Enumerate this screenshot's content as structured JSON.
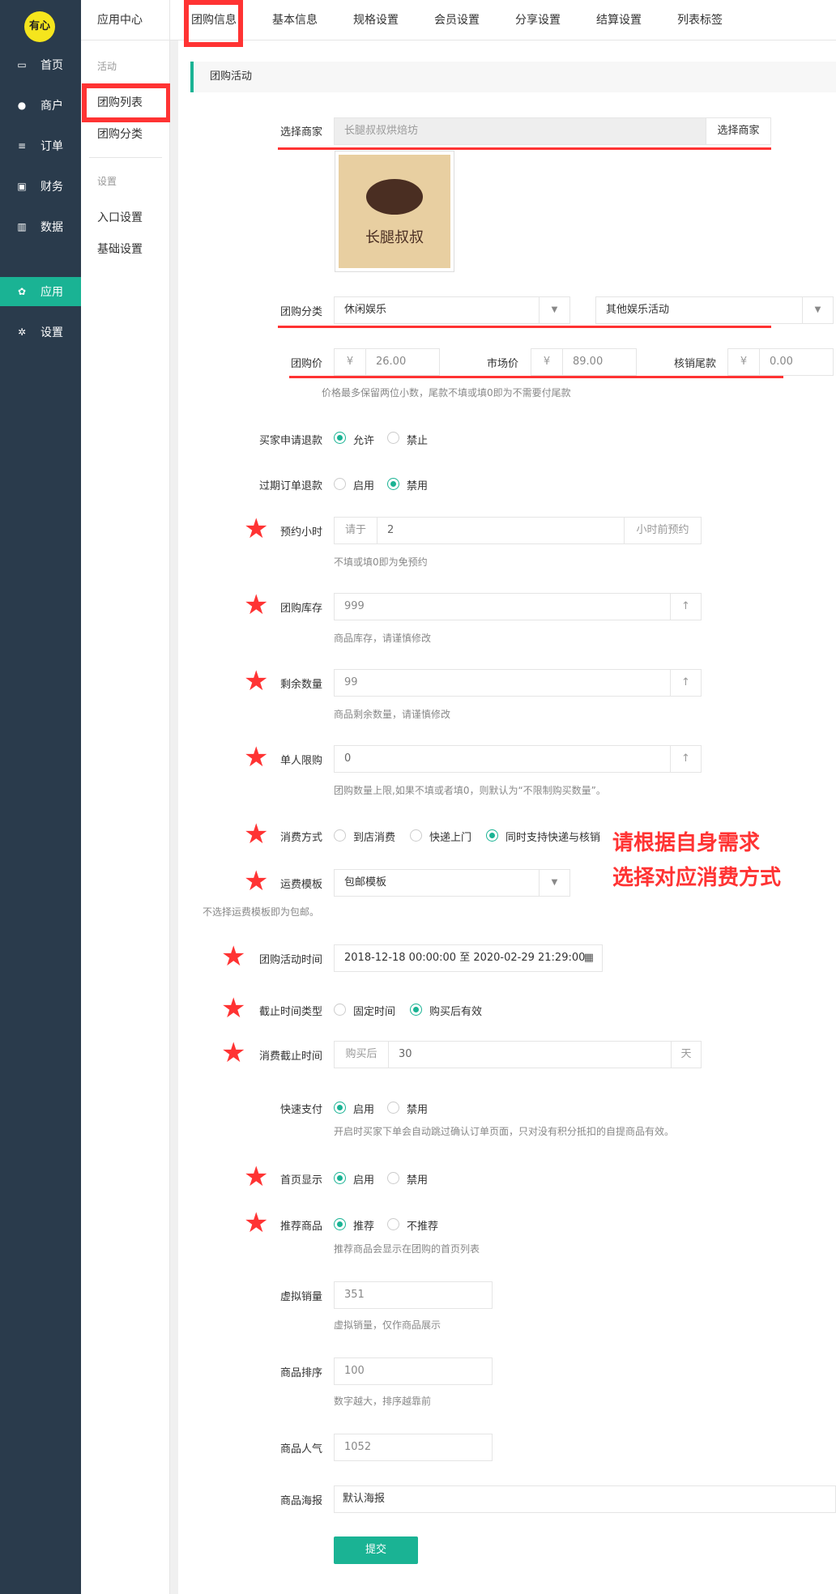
{
  "app": {
    "logo": "有心"
  },
  "nav": [
    {
      "label": "首页",
      "icon": "monitor-icon"
    },
    {
      "label": "商户",
      "icon": "users-icon"
    },
    {
      "label": "订单",
      "icon": "list-icon"
    },
    {
      "label": "财务",
      "icon": "money-icon"
    },
    {
      "label": "数据",
      "icon": "chart-icon"
    },
    {
      "label": "应用",
      "icon": "apps-icon"
    },
    {
      "label": "设置",
      "icon": "gear-icon"
    }
  ],
  "subnav": {
    "title": "应用中心",
    "group1": "活动",
    "items1": [
      "团购列表",
      "团购分类"
    ],
    "group2": "设置",
    "items2": [
      "入口设置",
      "基础设置"
    ]
  },
  "tabs": [
    "团购信息",
    "基本信息",
    "规格设置",
    "会员设置",
    "分享设置",
    "结算设置",
    "列表标签"
  ],
  "section": "团购活动",
  "form": {
    "merchant_label": "选择商家",
    "merchant_value": "长腿叔叔烘焙坊",
    "merchant_button": "选择商家",
    "image_close": "×",
    "image_brand": "长腿叔叔",
    "category_label": "团购分类",
    "category1": "休闲娱乐",
    "category2": "其他娱乐活动",
    "price_label": "团购价",
    "price_currency": "¥",
    "price_value": "26.00",
    "market_label": "市场价",
    "market_value": "89.00",
    "balance_label": "核销尾款",
    "balance_value": "0.00",
    "price_help": "价格最多保留两位小数，尾款不填或填0即为不需要付尾款",
    "refund_label": "买家申请退款",
    "refund_opts": [
      "允许",
      "禁止"
    ],
    "expired_label": "过期订单退款",
    "expired_opts": [
      "启用",
      "禁用"
    ],
    "book_label": "预约小时",
    "book_prefix": "请于",
    "book_value": "2",
    "book_suffix": "小时前预约",
    "book_help": "不填或填0即为免预约",
    "stock_label": "团购库存",
    "stock_value": "999",
    "stock_help": "商品库存，请谨慎修改",
    "remain_label": "剩余数量",
    "remain_value": "99",
    "remain_help": "商品剩余数量，请谨慎修改",
    "limit_label": "单人限购",
    "limit_value": "0",
    "limit_help": "团购数量上限,如果不填或者填0，则默认为“不限制购买数量”。",
    "consume_label": "消费方式",
    "consume_opts": [
      "到店消费",
      "快递上门",
      "同时支持快递与核销"
    ],
    "freight_label": "运费模板",
    "freight_value": "包邮模板",
    "freight_help": "不选择运费模板即为包邮。",
    "time_label": "团购活动时间",
    "time_value": "2018-12-18 00:00:00 至 2020-02-29 21:29:00",
    "deadline_type_label": "截止时间类型",
    "deadline_type_opts": [
      "固定时间",
      "购买后有效"
    ],
    "deadline_label": "消费截止时间",
    "deadline_prefix": "购买后",
    "deadline_value": "30",
    "deadline_suffix": "天",
    "fastpay_label": "快速支付",
    "fastpay_opts": [
      "启用",
      "禁用"
    ],
    "fastpay_help": "开启时买家下单会自动跳过确认订单页面，只对没有积分抵扣的自提商品有效。",
    "home_label": "首页显示",
    "home_opts": [
      "启用",
      "禁用"
    ],
    "recommend_label": "推荐商品",
    "recommend_opts": [
      "推荐",
      "不推荐"
    ],
    "recommend_help": "推荐商品会显示在团购的首页列表",
    "virtual_label": "虚拟销量",
    "virtual_value": "351",
    "virtual_help": "虚拟销量，仅作商品展示",
    "sort_label": "商品排序",
    "sort_value": "100",
    "sort_help": "数字越大，排序越靠前",
    "pop_label": "商品人气",
    "pop_value": "1052",
    "poster_label": "商品海报",
    "poster_value": "默认海报",
    "submit": "提交",
    "up_arrow": "↑"
  },
  "annotation": {
    "line1": "请根据自身需求",
    "line2": "选择对应消费方式"
  },
  "colors": {
    "sidebar": "#2a3b4c",
    "accent": "#1ab394",
    "mark": "#ff3333"
  }
}
